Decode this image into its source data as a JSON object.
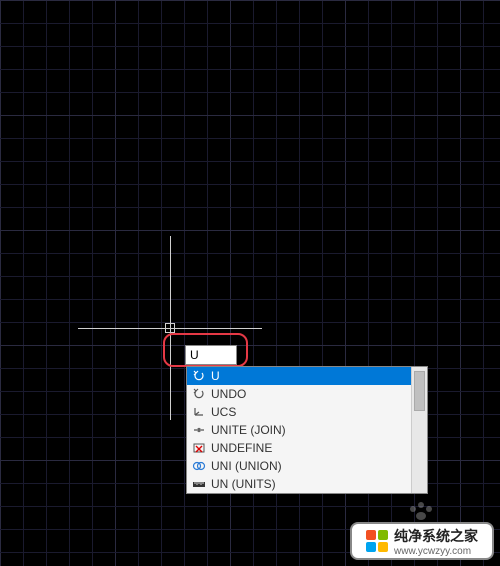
{
  "command_input": {
    "value": "U"
  },
  "autocomplete": {
    "items": [
      {
        "icon": "undo-arrow-icon",
        "label": "U",
        "selected": true
      },
      {
        "icon": "undo-arrow-icon",
        "label": "UNDO",
        "selected": false
      },
      {
        "icon": "ucs-axis-icon",
        "label": "UCS",
        "selected": false
      },
      {
        "icon": "join-icon",
        "label": "UNITE (JOIN)",
        "selected": false
      },
      {
        "icon": "undefine-icon",
        "label": "UNDEFINE",
        "selected": false
      },
      {
        "icon": "union-circles-icon",
        "label": "UNI (UNION)",
        "selected": false
      },
      {
        "icon": "units-ruler-icon",
        "label": "UN (UNITS)",
        "selected": false
      }
    ]
  },
  "watermark": {
    "title": "纯净系统之家",
    "url": "www.ycwzyy.com"
  }
}
